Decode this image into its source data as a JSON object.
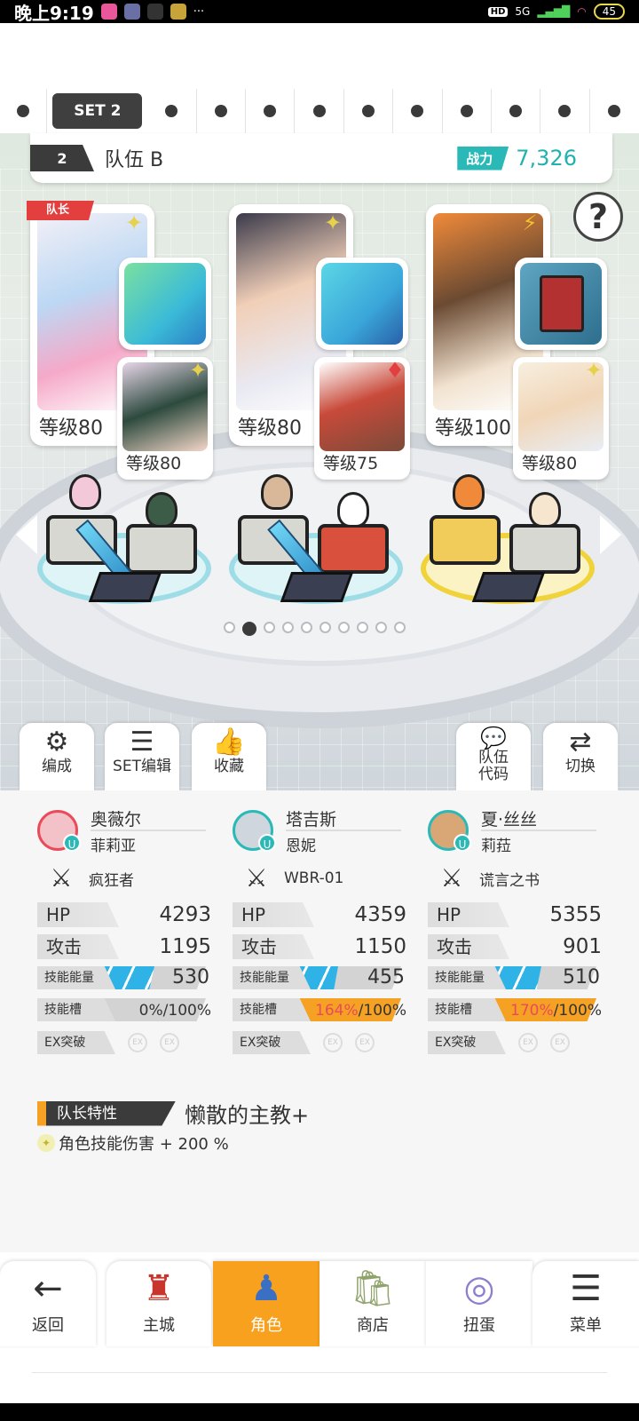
{
  "status_bar": {
    "time": "晚上9:19",
    "network": "5G",
    "hd": "HD",
    "battery": "45",
    "more": "···"
  },
  "set_bar": {
    "current": "SET 2"
  },
  "team": {
    "number": "2",
    "name": "队伍 B",
    "power_label": "战力",
    "power_value": "7,326"
  },
  "help": "?",
  "captain_label": "队长",
  "characters": [
    {
      "level_label": "等级",
      "level": "80",
      "sub_level_label": "等级",
      "sub_level": "80"
    },
    {
      "level_label": "等级",
      "level": "80",
      "sub_level_label": "等级",
      "sub_level": "75"
    },
    {
      "level_label": "等级",
      "level": "100",
      "sub_level_label": "等级",
      "sub_level": "80"
    }
  ],
  "actions": {
    "formation": "编成",
    "set_edit": "SET编辑",
    "favorite": "收藏",
    "team_code_line1": "队伍",
    "team_code_line2": "代码",
    "switch": "切换"
  },
  "stat_labels": {
    "hp": "HP",
    "attack": "攻击",
    "skill_energy": "技能能量",
    "skill_slot": "技能槽",
    "ex": "EX突破",
    "ex_icon": "EX"
  },
  "members": [
    {
      "name": "奥薇尔",
      "sub": "菲莉亚",
      "weapon": "疯狂者",
      "hp": "4293",
      "attack": "1195",
      "energy": "530",
      "energy_pct": 0.55,
      "slot_value": "0",
      "slot_max": "100",
      "slot_pct": 0.0
    },
    {
      "name": "塔吉斯",
      "sub": "恩妮",
      "weapon": "WBR-01",
      "hp": "4359",
      "attack": "1150",
      "energy": "455",
      "energy_pct": 0.45,
      "slot_value": "164",
      "slot_max": "100",
      "slot_pct": 1.0
    },
    {
      "name": "夏·丝丝",
      "sub": "莉菈",
      "weapon": "谎言之书",
      "hp": "5355",
      "attack": "901",
      "energy": "510",
      "energy_pct": 0.52,
      "slot_value": "170",
      "slot_max": "100",
      "slot_pct": 1.0
    }
  ],
  "leader": {
    "label": "队长特性",
    "name": "懒散的主教+",
    "desc": "角色技能伤害 + 200 %"
  },
  "nav": {
    "back": "返回",
    "main": "主城",
    "chars": "角色",
    "shop": "商店",
    "gacha": "扭蛋",
    "menu": "菜单"
  },
  "colors": {
    "accent": "#2ab9b7",
    "active_nav": "#f7a11e",
    "captain": "#e33f3f"
  }
}
